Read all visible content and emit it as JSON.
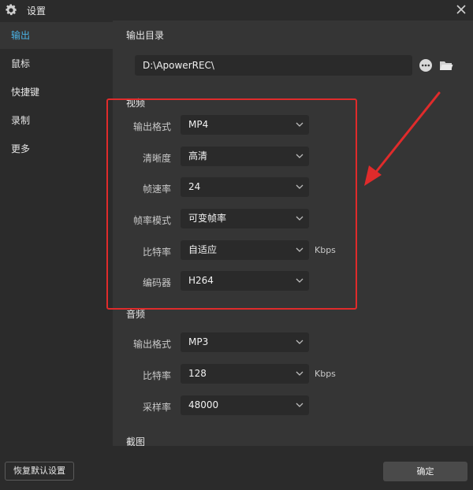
{
  "window": {
    "title": "设置"
  },
  "sidebar": {
    "items": [
      {
        "label": "输出",
        "active": true
      },
      {
        "label": "鼠标"
      },
      {
        "label": "快捷键"
      },
      {
        "label": "录制"
      },
      {
        "label": "更多"
      }
    ]
  },
  "output_dir": {
    "title": "输出目录",
    "path": "D:\\ApowerREC\\"
  },
  "video": {
    "title": "视频",
    "format": {
      "label": "输出格式",
      "value": "MP4"
    },
    "quality": {
      "label": "清晰度",
      "value": "高清"
    },
    "framerate": {
      "label": "帧速率",
      "value": "24"
    },
    "frame_mode": {
      "label": "帧率模式",
      "value": "可变帧率"
    },
    "bitrate": {
      "label": "比特率",
      "value": "自适应",
      "unit": "Kbps"
    },
    "encoder": {
      "label": "编码器",
      "value": "H264"
    }
  },
  "audio": {
    "title": "音频",
    "format": {
      "label": "输出格式",
      "value": "MP3"
    },
    "bitrate": {
      "label": "比特率",
      "value": "128",
      "unit": "Kbps"
    },
    "samplerate": {
      "label": "采样率",
      "value": "48000"
    }
  },
  "screenshot": {
    "title": "截图"
  },
  "footer": {
    "reset_label": "恢复默认设置",
    "ok_label": "确定"
  },
  "colors": {
    "accent": "#4ab3e6",
    "annotation": "#e02b2b"
  }
}
